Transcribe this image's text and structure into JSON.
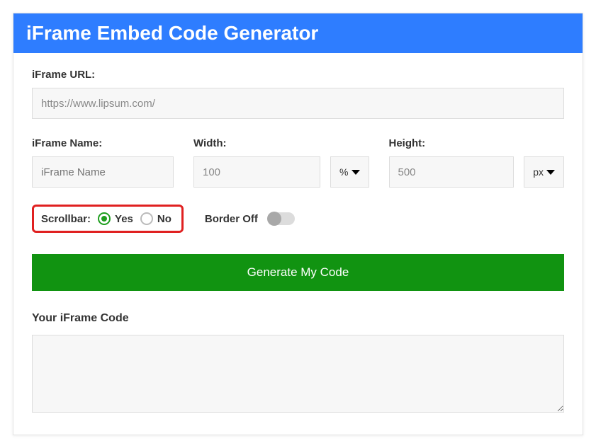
{
  "header": {
    "title": "iFrame Embed Code Generator"
  },
  "url": {
    "label": "iFrame URL:",
    "value": "https://www.lipsum.com/"
  },
  "name": {
    "label": "iFrame Name:",
    "placeholder": "iFrame Name",
    "value": ""
  },
  "width": {
    "label": "Width:",
    "value": "100",
    "unit": "%"
  },
  "height": {
    "label": "Height:",
    "value": "500",
    "unit": "px"
  },
  "scrollbar": {
    "label": "Scrollbar:",
    "yes": "Yes",
    "no": "No",
    "selected": "yes"
  },
  "border": {
    "label": "Border Off",
    "on": false
  },
  "generate": {
    "label": "Generate My Code"
  },
  "output": {
    "label": "Your iFrame Code",
    "value": ""
  }
}
